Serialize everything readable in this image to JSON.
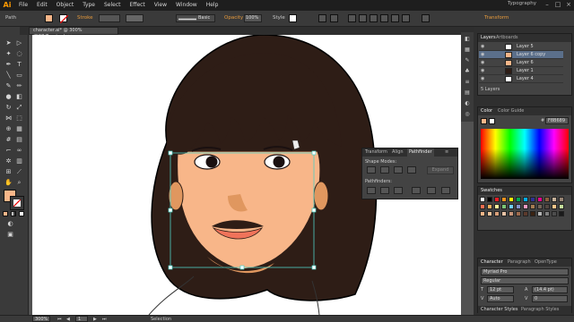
{
  "menubar": {
    "logo": "Ai",
    "items": [
      "File",
      "Edit",
      "Object",
      "Type",
      "Select",
      "Effect",
      "View",
      "Window",
      "Help"
    ],
    "workspace": "Typography"
  },
  "controlbar": {
    "selection_type": "Path",
    "stroke_label": "Stroke",
    "brush_label": "Basic",
    "opacity_label": "Opacity",
    "opacity_value": "100%",
    "style_label": "Style",
    "transform_label": "Transform"
  },
  "document": {
    "tab_title": "character.ai* @ 300% (RGB/Preview)"
  },
  "pathfinder": {
    "tabs": [
      "Transform",
      "Align",
      "Pathfinder"
    ],
    "shape_modes_label": "Shape Modes:",
    "pathfinders_label": "Pathfinders:",
    "expand_label": "Expand"
  },
  "layers": {
    "tabs": [
      "Layers",
      "Artboards"
    ],
    "rows": [
      "Layer 5",
      "Layer 6 copy",
      "Layer 6",
      "Layer 1",
      "Layer 4"
    ],
    "selected_index": 1,
    "footer": "5 Layers"
  },
  "color": {
    "tabs": [
      "Color",
      "Color Guide"
    ],
    "hex": "F8B689",
    "hex_prefix": "#"
  },
  "swatches": {
    "title": "Swatches",
    "colors": [
      "#ffffff",
      "#000000",
      "#ed1c24",
      "#f7941d",
      "#fff200",
      "#00a651",
      "#00aeef",
      "#2e3192",
      "#ec008c",
      "#8b5e3c",
      "#c7b299",
      "#998675",
      "#f26c4f",
      "#fbaf5d",
      "#fff799",
      "#7cc576",
      "#6dcff6",
      "#8393ca",
      "#f49ac1",
      "#a67c52",
      "#736357",
      "#534741",
      "#fdc68a",
      "#c4df9b",
      "#f8b689",
      "#f2c49b",
      "#d9a07a",
      "#e8c3a6",
      "#c9967a",
      "#9e6b4e",
      "#5c3a2c",
      "#3b2313",
      "#b3b3b3",
      "#808080",
      "#4d4d4d",
      "#1a1a1a"
    ]
  },
  "character": {
    "tabs": [
      "Character",
      "Paragraph",
      "OpenType"
    ],
    "font": "Myriad Pro",
    "style": "Regular",
    "size": "12 pt",
    "leading": "(14.4 pt)",
    "kerning": "Auto",
    "tracking": "0",
    "bottom_tabs": [
      "Character Styles",
      "Paragraph Styles"
    ]
  },
  "statusbar": {
    "zoom": "300%",
    "artboard_num": "1",
    "tool": "Selection"
  },
  "colors": {
    "hair": "#2e1d16",
    "skin": "#f8b689",
    "skin_shadow": "#e0975f",
    "lips": "#f0735a",
    "eye": "#1a1010",
    "selection": "#4fd1c5"
  }
}
